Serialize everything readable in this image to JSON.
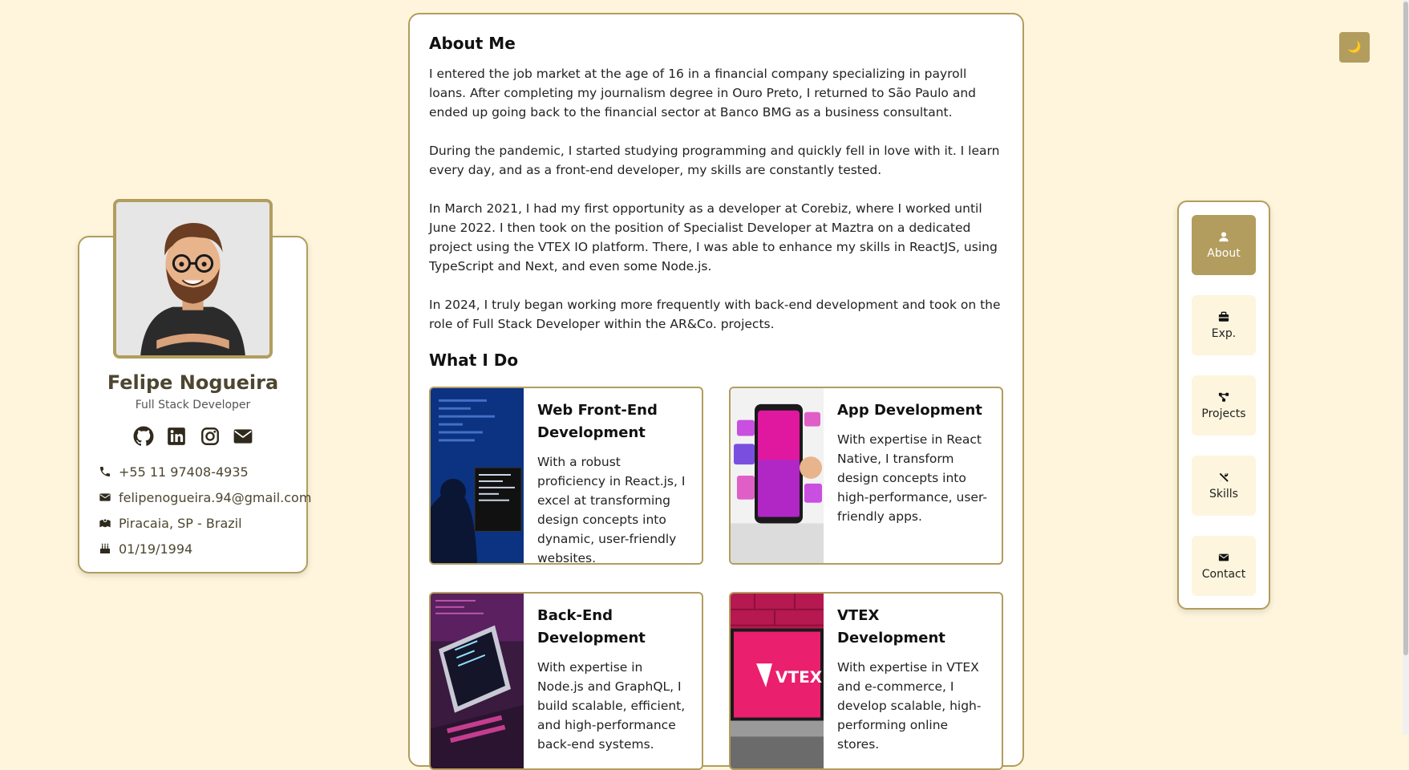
{
  "profile": {
    "name": "Felipe Nogueira",
    "role": "Full Stack Developer",
    "socials": [
      "github-icon",
      "linkedin-icon",
      "instagram-icon",
      "envelope-icon"
    ],
    "contacts": [
      {
        "icon": "phone-icon",
        "text": "+55 11 97408-4935"
      },
      {
        "icon": "envelope-icon",
        "text": "felipenogueira.94@gmail.com"
      },
      {
        "icon": "map-location-icon",
        "text": "Piracaia, SP - Brazil"
      },
      {
        "icon": "cake-icon",
        "text": "01/19/1994"
      }
    ]
  },
  "about": {
    "title": "About Me",
    "paragraphs": [
      "I entered the job market at the age of 16 in a financial company specializing in payroll loans. After completing my journalism degree in Ouro Preto, I returned to São Paulo and ended up going back to the financial sector at Banco BMG as a business consultant.",
      "During the pandemic, I started studying programming and quickly fell in love with it. I learn every day, and as a front-end developer, my skills are constantly tested.",
      "In March 2021, I had my first opportunity as a developer at Corebiz, where I worked until June 2022. I then took on the position of Specialist Developer at Maztra on a dedicated project using the VTEX IO platform. There, I was able to enhance my skills in ReactJS, using TypeScript and Next, and even some Node.js.",
      "In 2024, I truly began working more frequently with back-end development and took on the role of Full Stack Developer within the AR&Co. projects."
    ]
  },
  "what_i_do": {
    "title": "What I Do",
    "services": [
      {
        "title": "Web Front-End Development",
        "description": "With a robust proficiency in React.js, I excel at transforming design concepts into dynamic, user-friendly websites."
      },
      {
        "title": "App Development",
        "description": "With expertise in React Native, I transform design concepts into high-performance, user-friendly apps."
      },
      {
        "title": "Back-End Development",
        "description": "With expertise in Node.js and GraphQL, I build scalable, efficient, and high-performance back-end systems."
      },
      {
        "title": "VTEX Development",
        "description": "With expertise in VTEX and e-commerce, I develop scalable, high-performing online stores.",
        "image_label": "VTEX"
      }
    ]
  },
  "nav": {
    "items": [
      {
        "label": "About",
        "icon": "user-icon",
        "active": true
      },
      {
        "label": "Exp.",
        "icon": "briefcase-icon",
        "active": false
      },
      {
        "label": "Projects",
        "icon": "diagram-icon",
        "active": false
      },
      {
        "label": "Skills",
        "icon": "tools-icon",
        "active": false
      },
      {
        "label": "Contact",
        "icon": "envelope-icon",
        "active": false
      }
    ]
  },
  "theme_toggle": {
    "icon": "moon-icon",
    "glyph": "🌙"
  },
  "colors": {
    "accent": "#b29d5e",
    "background": "#fef5dc",
    "text_dark": "#4d4630"
  }
}
